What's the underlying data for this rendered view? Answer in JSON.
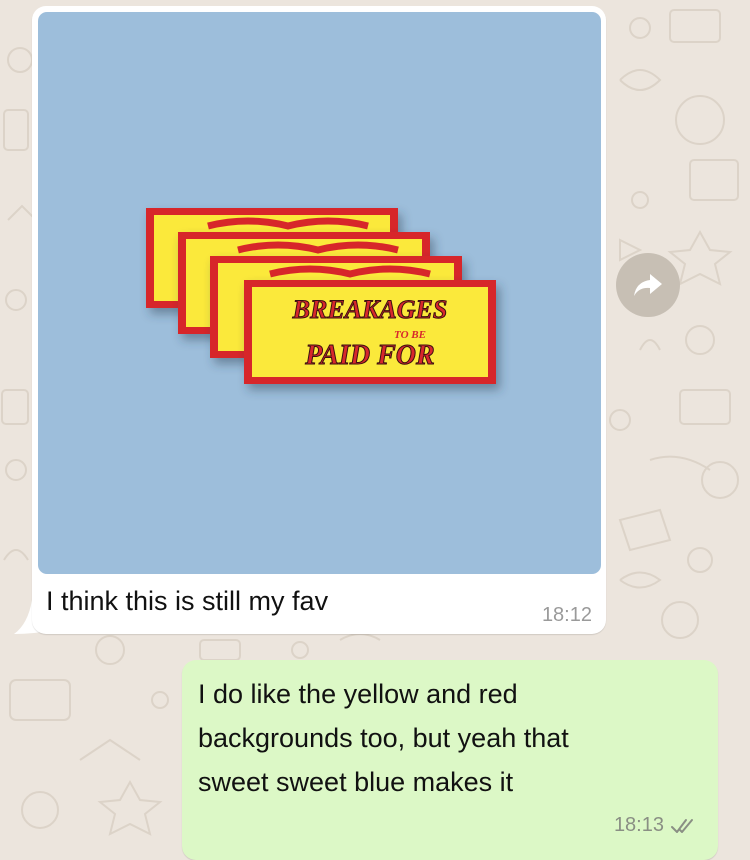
{
  "chat": {
    "incoming": {
      "caption": "I think this is still my fav",
      "time": "18:12",
      "photo": {
        "background": "#9dbedb",
        "sign_top_text": "BREAKAGES",
        "sign_small_text": "TO BE",
        "sign_bottom_text": "PAID FOR"
      }
    },
    "outgoing": {
      "line1": "I do like the yellow and red",
      "line2": "backgrounds too, but yeah that",
      "line3": "sweet sweet blue makes it",
      "time": "18:13",
      "status_icon": "double-check-icon"
    },
    "forward_icon": "forward-arrow-icon"
  },
  "colors": {
    "wallpaper": "#ece5dd",
    "incoming_bubble": "#ffffff",
    "outgoing_bubble": "#dcf8c6",
    "sign_yellow": "#fbe93b",
    "sign_red": "#d7282c"
  }
}
